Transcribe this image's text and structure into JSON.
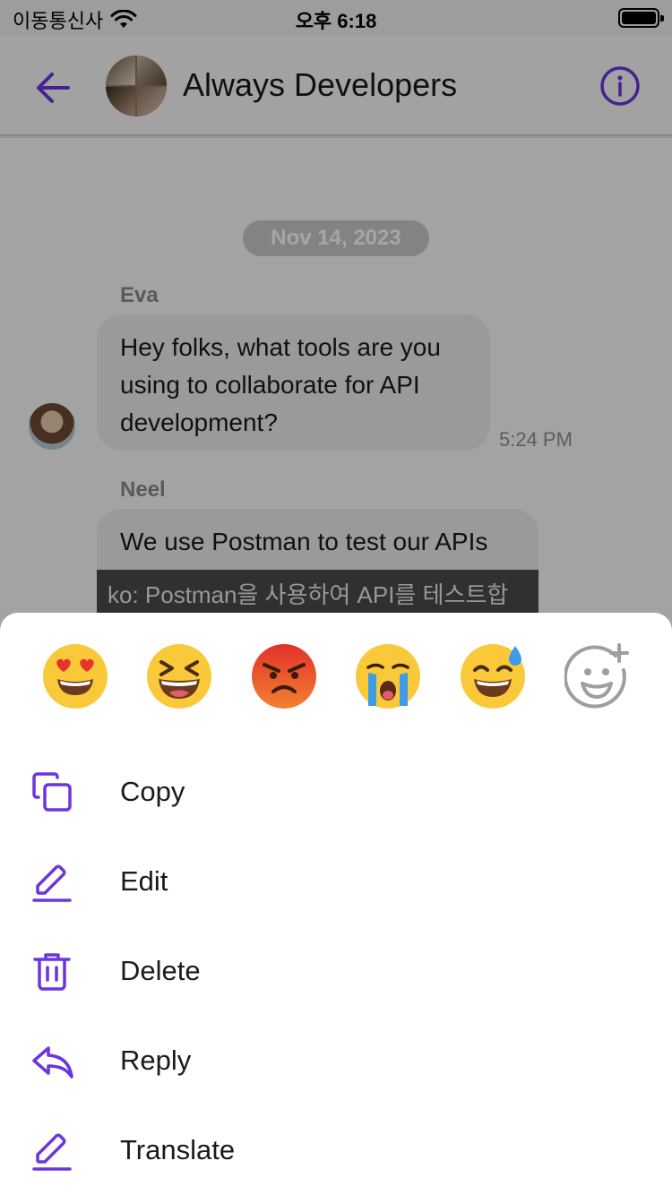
{
  "status_bar": {
    "carrier": "이동통신사",
    "time": "오후 6:18"
  },
  "header": {
    "title": "Always Developers",
    "back_icon": "arrow-left-icon",
    "info_icon": "info-icon"
  },
  "chat": {
    "date": "Nov 14, 2023",
    "messages": [
      {
        "sender": "Eva",
        "line1": "Hey folks, what tools are you",
        "line2": "using to collaborate for API",
        "line3": "development?",
        "time": "5:24 PM"
      },
      {
        "sender": "Neel",
        "text": "We use Postman to test our APIs",
        "translation": "ko: Postman을 사용하여 API를 테스트합"
      }
    ]
  },
  "reactions": [
    "heart-eyes",
    "laughing",
    "angry",
    "crying",
    "sweat-smile",
    "add-reaction"
  ],
  "menu": {
    "copy": "Copy",
    "edit": "Edit",
    "delete": "Delete",
    "reply": "Reply",
    "translate": "Translate"
  },
  "colors": {
    "accent": "#6c35de",
    "emoji_yellow": "#f9c93a",
    "angry_red": "#e8472e"
  }
}
